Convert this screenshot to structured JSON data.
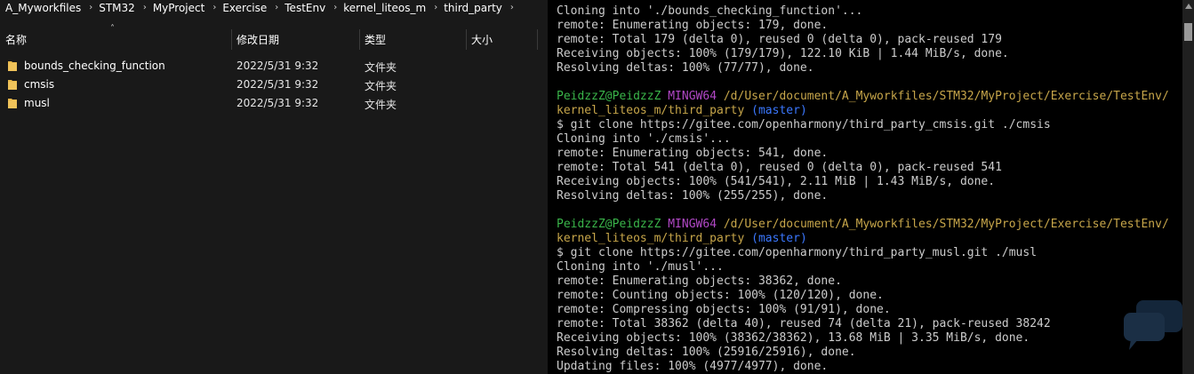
{
  "explorer": {
    "breadcrumb": [
      "A_Myworkfiles",
      "STM32",
      "MyProject",
      "Exercise",
      "TestEnv",
      "kernel_liteos_m",
      "third_party"
    ],
    "columns": {
      "name": "名称",
      "date": "修改日期",
      "type": "类型",
      "size": "大小"
    },
    "sort_icon": "sort-up-arrow",
    "files": [
      {
        "name": "bounds_checking_function",
        "date": "2022/5/31 9:32",
        "type": "文件夹",
        "icon": "folder-icon"
      },
      {
        "name": "cmsis",
        "date": "2022/5/31 9:32",
        "type": "文件夹",
        "icon": "folder-icon"
      },
      {
        "name": "musl",
        "date": "2022/5/31 9:32",
        "type": "文件夹",
        "icon": "folder-icon"
      }
    ],
    "colors": {
      "background": "#191919",
      "folder": "#e8b84a",
      "text": "#ffffff"
    }
  },
  "terminal": {
    "lines": [
      {
        "text": "Cloning into './bounds_checking_function'..."
      },
      {
        "text": "remote: Enumerating objects: 179, done."
      },
      {
        "text": "remote: Total 179 (delta 0), reused 0 (delta 0), pack-reused 179"
      },
      {
        "text": "Receiving objects: 100% (179/179), 122.10 KiB | 1.44 MiB/s, done."
      },
      {
        "text": "Resolving deltas: 100% (77/77), done."
      },
      {
        "text": ""
      },
      {
        "prompt": {
          "user": "PeidzzZ@PeidzzZ",
          "env": "MINGW64",
          "path": "/d/User/document/A_Myworkfiles/STM32/MyProject/Exercise/TestEnv/"
        }
      },
      {
        "prompt_cont": {
          "path": "kernel_liteos_m/third_party",
          "branch": "(master)"
        }
      },
      {
        "text": "$ git clone https://gitee.com/openharmony/third_party_cmsis.git ./cmsis"
      },
      {
        "text": "Cloning into './cmsis'..."
      },
      {
        "text": "remote: Enumerating objects: 541, done."
      },
      {
        "text": "remote: Total 541 (delta 0), reused 0 (delta 0), pack-reused 541"
      },
      {
        "text": "Receiving objects: 100% (541/541), 2.11 MiB | 1.43 MiB/s, done."
      },
      {
        "text": "Resolving deltas: 100% (255/255), done."
      },
      {
        "text": ""
      },
      {
        "prompt": {
          "user": "PeidzzZ@PeidzzZ",
          "env": "MINGW64",
          "path": "/d/User/document/A_Myworkfiles/STM32/MyProject/Exercise/TestEnv/"
        }
      },
      {
        "prompt_cont": {
          "path": "kernel_liteos_m/third_party",
          "branch": "(master)"
        }
      },
      {
        "text": "$ git clone https://gitee.com/openharmony/third_party_musl.git ./musl"
      },
      {
        "text": "Cloning into './musl'..."
      },
      {
        "text": "remote: Enumerating objects: 38362, done."
      },
      {
        "text": "remote: Counting objects: 100% (120/120), done."
      },
      {
        "text": "remote: Compressing objects: 100% (91/91), done."
      },
      {
        "text": "remote: Total 38362 (delta 40), reused 74 (delta 21), pack-reused 38242"
      },
      {
        "text": "Receiving objects: 100% (38362/38362), 13.68 MiB | 3.35 MiB/s, done."
      },
      {
        "text": "Resolving deltas: 100% (25916/25916), done."
      },
      {
        "text": "Updating files: 100% (4977/4977), done."
      }
    ],
    "colors": {
      "background": "#000000",
      "text": "#cccccc",
      "user": "#3ab54a",
      "env": "#b148c6",
      "path": "#c7a64a",
      "branch": "#3b78ff"
    }
  }
}
